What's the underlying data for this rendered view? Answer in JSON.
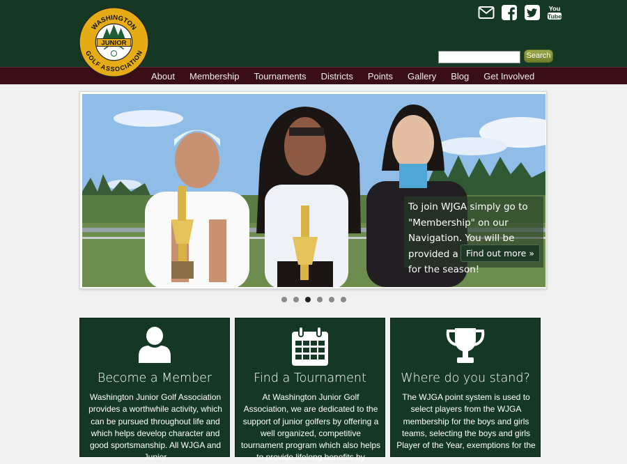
{
  "header": {
    "logo": {
      "top_text": "WASHINGTON",
      "center_text": "JUNIOR",
      "bottom_text": "GOLF ASSOCIATION"
    },
    "social": [
      "email-icon",
      "facebook-icon",
      "twitter-icon",
      "youtube-icon"
    ],
    "search": {
      "value": "",
      "placeholder": "",
      "button_label": "Search"
    }
  },
  "nav": {
    "items": [
      "About",
      "Membership",
      "Tournaments",
      "Districts",
      "Points",
      "Gallery",
      "Blog",
      "Get Involved"
    ]
  },
  "slider": {
    "caption": "To join WJGA simply go to \"Membership\" on our Navigation. You will be provided a link to register for the season!",
    "button_label": "Find out more »",
    "dot_count": 6,
    "active_dot": 3
  },
  "cards": [
    {
      "icon": "user-icon",
      "title": "Become a Member",
      "text": "Washington Junior Golf Association provides a worthwhile activity, which can be pursued throughout life and which helps develop character and good sportsmanship. All WJGA and Junior"
    },
    {
      "icon": "calendar-icon",
      "title": "Find a Tournament",
      "text": "At Washington Junior Golf Association, we are dedicated to the support of junior golfers by offering a well organized, competitive tournament program which also helps to provide lifelong benefits by"
    },
    {
      "icon": "trophy-icon",
      "title": "Where do you stand?",
      "text": "The WJGA point system is used to select players from the WJGA membership for the boys and girls teams, selecting the boys and girls Player of the Year, exemptions for the"
    }
  ],
  "colors": {
    "header_bg": "#153825",
    "nav_bg": "#3a0e17",
    "card_bg": "#153825",
    "logo_gold": "#e5ac16",
    "search_button": "#7f8e33"
  }
}
